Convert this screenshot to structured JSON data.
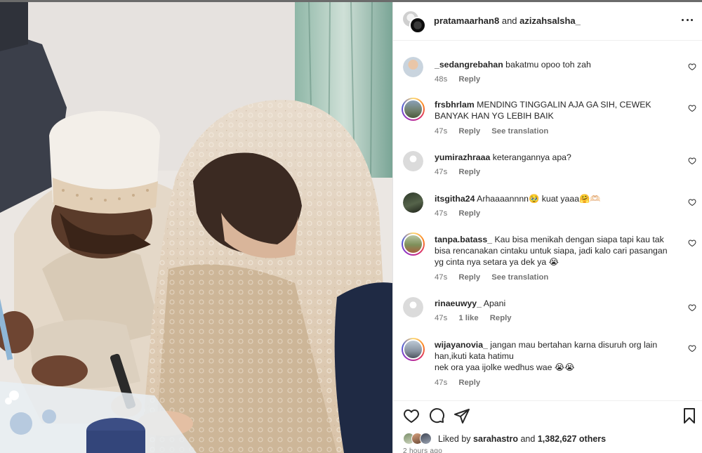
{
  "header": {
    "user1": "pratamaarhan8",
    "connector": "and",
    "user2": "azizahsalsha_"
  },
  "comments": [
    {
      "username": "_sedangrebahan",
      "text": "bakatmu opoo toh zah",
      "time": "48s",
      "reply": "Reply",
      "translation": null
    },
    {
      "username": "frsbhrlam",
      "text": "MENDING TINGGALIN AJA GA SIH, CEWEK",
      "text2": "BANYAK HAN YG LEBIH BAIK",
      "time": "47s",
      "reply": "Reply",
      "translation": "See translation"
    },
    {
      "username": "yumirazhraaa",
      "text": "keterangannya apa?",
      "time": "47s",
      "reply": "Reply",
      "translation": null
    },
    {
      "username": "itsgitha24",
      "text": "Arhaaaannnn🥹 kuat yaaa🤗🫶🏻",
      "time": "47s",
      "reply": "Reply",
      "translation": null
    },
    {
      "username": "tanpa.batass_",
      "text": "Kau bisa menikah dengan siapa tapi kau tak",
      "text2": "bisa rencanakan cintaku untuk siapa, jadi kalo cari pasangan",
      "text3": "yg cinta nya setara ya dek ya 😭",
      "time": "47s",
      "reply": "Reply",
      "translation": "See translation"
    },
    {
      "username": "rinaeuwyy_",
      "text": "Apani",
      "time": "47s",
      "likes": "1 like",
      "reply": "Reply",
      "translation": null
    },
    {
      "username": "wijayanovia_",
      "text": "jangan mau bertahan karna disuruh org lain",
      "text2": "han,ikuti kata hatimu",
      "text3": "nek ora yaa ijolke wedhus wae 😭😭",
      "time": "47s",
      "reply": "Reply",
      "translation": null
    }
  ],
  "footer": {
    "liked_prefix": "Liked by",
    "liked_user": "sarahastro",
    "liked_and": "and",
    "liked_others": "1,382,627 others",
    "time_ago": "2 hours ago"
  },
  "icons": {
    "more": "more-horizontal-icon",
    "heart": "heart-icon",
    "comment": "comment-icon",
    "share": "paper-plane-icon",
    "save": "bookmark-icon"
  },
  "colors": {
    "text": "#262626",
    "meta": "#737373",
    "divider": "#efefef"
  }
}
